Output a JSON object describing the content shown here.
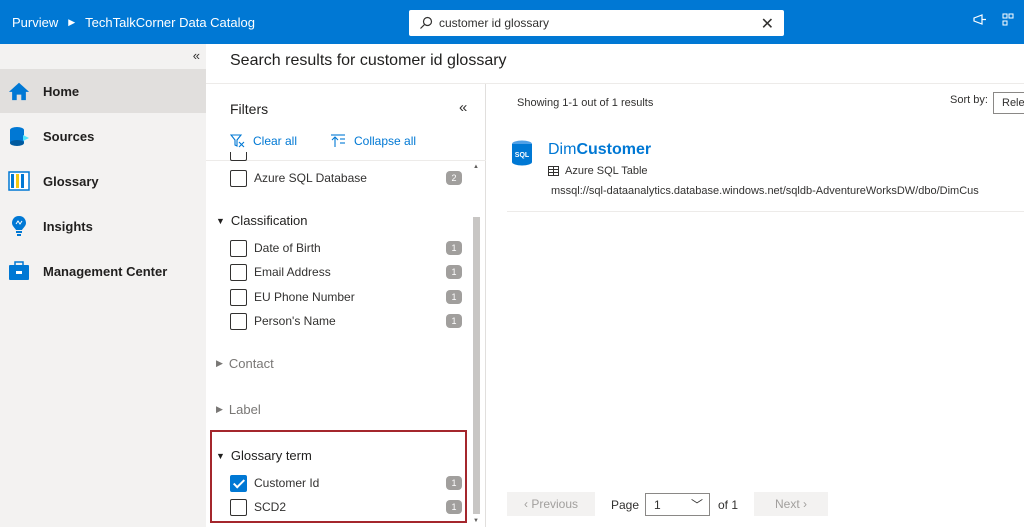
{
  "topbar": {
    "app": "Purview",
    "catalog": "TechTalkCorner Data Catalog",
    "search_value": "customer id glossary",
    "clear": "✕"
  },
  "nav": {
    "collapse": "«",
    "items": [
      {
        "label": "Home",
        "icon": "home-icon"
      },
      {
        "label": "Sources",
        "icon": "sources-icon"
      },
      {
        "label": "Glossary",
        "icon": "glossary-icon"
      },
      {
        "label": "Insights",
        "icon": "insights-icon"
      },
      {
        "label": "Management Center",
        "icon": "management-icon"
      }
    ]
  },
  "page_title": "Search results for customer id glossary",
  "filters": {
    "title": "Filters",
    "collapse": "«",
    "clear_all": "Clear all",
    "collapse_all": "Collapse all",
    "top_option": {
      "label": "Azure SQL Database",
      "count": "2"
    },
    "classification": {
      "title": "Classification",
      "options": [
        {
          "label": "Date of Birth",
          "count": "1"
        },
        {
          "label": "Email Address",
          "count": "1"
        },
        {
          "label": "EU Phone Number",
          "count": "1"
        },
        {
          "label": "Person's Name",
          "count": "1"
        }
      ]
    },
    "contact": "Contact",
    "label": "Label",
    "glossary": {
      "title": "Glossary term",
      "options": [
        {
          "label": "Customer Id",
          "count": "1",
          "checked": true
        },
        {
          "label": "SCD2",
          "count": "1",
          "checked": false
        }
      ]
    }
  },
  "results": {
    "showing": "Showing 1-1 out of 1 results",
    "sort_label": "Sort by:",
    "sort_value": "Rele",
    "item": {
      "title_plain": "Dim",
      "title_bold": "Customer",
      "icon_text": "SQL",
      "type": "Azure SQL Table",
      "path": "mssql://sql-dataanalytics.database.windows.net/sqldb-AdventureWorksDW/dbo/DimCus"
    }
  },
  "pagination": {
    "previous": "‹ Previous",
    "page_label": "Page",
    "page_value": "1",
    "of_label": "of 1",
    "next": "Next ›"
  },
  "colors": {
    "accent": "#0078d4",
    "highlight": "#a4262c"
  }
}
